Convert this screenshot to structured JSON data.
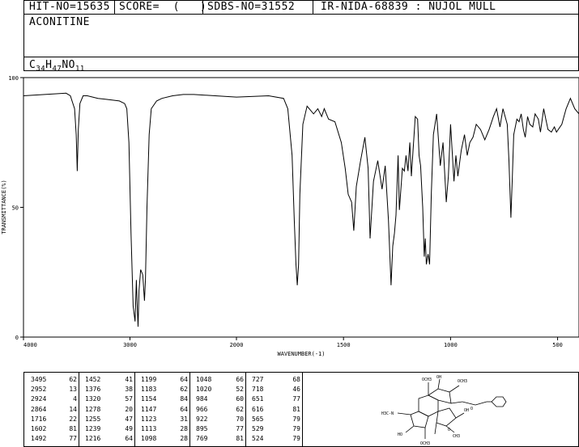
{
  "header": {
    "hit_no": "HIT-NO=15635",
    "score": "SCORE=  (   )",
    "sdbs_no": "SDBS-NO=31552",
    "ir_info": "IR-NIDA-68839 : NUJOL MULL"
  },
  "compound": {
    "name": "ACONITINE",
    "formula_parts": [
      "C",
      "34",
      "H",
      "47",
      "NO",
      "11"
    ]
  },
  "chart_data": {
    "type": "line",
    "xlabel": "WAVENUMBER(-1)",
    "ylabel": "TRANSMITTANCE(%)",
    "xlim": [
      4000,
      400
    ],
    "ylim": [
      0,
      100
    ],
    "x_ticks": [
      4000,
      3000,
      2000,
      1500,
      1000,
      500
    ],
    "y_ticks": [
      0,
      50,
      100
    ],
    "grid": false,
    "x": [
      4000,
      3800,
      3600,
      3560,
      3520,
      3505,
      3495,
      3485,
      3470,
      3440,
      3400,
      3300,
      3200,
      3100,
      3050,
      3030,
      3010,
      2990,
      2970,
      2952,
      2940,
      2930,
      2924,
      2915,
      2900,
      2880,
      2864,
      2855,
      2840,
      2820,
      2800,
      2750,
      2700,
      2600,
      2500,
      2400,
      2200,
      2000,
      1850,
      1780,
      1760,
      1740,
      1730,
      1722,
      1716,
      1710,
      1704,
      1690,
      1670,
      1640,
      1620,
      1602,
      1590,
      1570,
      1540,
      1510,
      1492,
      1478,
      1462,
      1452,
      1440,
      1420,
      1400,
      1385,
      1376,
      1360,
      1340,
      1320,
      1305,
      1290,
      1278,
      1270,
      1262,
      1255,
      1245,
      1239,
      1225,
      1216,
      1208,
      1199,
      1190,
      1183,
      1175,
      1165,
      1154,
      1147,
      1140,
      1130,
      1123,
      1118,
      1113,
      1105,
      1098,
      1090,
      1080,
      1065,
      1048,
      1035,
      1020,
      1010,
      1000,
      984,
      975,
      966,
      950,
      935,
      922,
      910,
      895,
      880,
      860,
      840,
      820,
      800,
      785,
      769,
      755,
      745,
      735,
      727,
      722,
      718,
      712,
      705,
      690,
      680,
      670,
      660,
      651,
      640,
      630,
      616,
      605,
      590,
      580,
      565,
      555,
      545,
      529,
      515,
      505,
      480,
      460,
      440,
      420,
      400
    ],
    "y": [
      93,
      93.5,
      94,
      93,
      88,
      78,
      64,
      80,
      90,
      93,
      93,
      92,
      91.5,
      91,
      90,
      88,
      75,
      40,
      12,
      6,
      22,
      10,
      4,
      18,
      26,
      24,
      14,
      22,
      50,
      78,
      88,
      91,
      92,
      93,
      93.5,
      93.5,
      93,
      92.5,
      93,
      92,
      88,
      70,
      45,
      28,
      20,
      28,
      55,
      82,
      89,
      86,
      88,
      85,
      88,
      84,
      83,
      75,
      65,
      55,
      52,
      41,
      58,
      68,
      77,
      65,
      38,
      60,
      68,
      57,
      66,
      45,
      20,
      35,
      40,
      47,
      70,
      49,
      65,
      64,
      70,
      64,
      75,
      62,
      72,
      85,
      84,
      70,
      66,
      50,
      31,
      38,
      28,
      32,
      28,
      55,
      78,
      86,
      66,
      75,
      52,
      62,
      82,
      60,
      70,
      62,
      72,
      78,
      70,
      75,
      77,
      82,
      80,
      76,
      80,
      85,
      88,
      81,
      88,
      85,
      82,
      68,
      55,
      46,
      60,
      78,
      84,
      83,
      86,
      80,
      77,
      85,
      82,
      81,
      86,
      84,
      79,
      88,
      84,
      80,
      79,
      81,
      79,
      82,
      88,
      92,
      88,
      86
    ]
  },
  "peaks": [
    [
      3495,
      62
    ],
    [
      2952,
      13
    ],
    [
      2924,
      4
    ],
    [
      2864,
      14
    ],
    [
      1716,
      22
    ],
    [
      1602,
      81
    ],
    [
      1492,
      77
    ],
    [
      1452,
      41
    ],
    [
      1376,
      38
    ],
    [
      1320,
      57
    ],
    [
      1278,
      20
    ],
    [
      1255,
      47
    ],
    [
      1239,
      49
    ],
    [
      1216,
      64
    ],
    [
      1199,
      64
    ],
    [
      1183,
      62
    ],
    [
      1154,
      84
    ],
    [
      1147,
      64
    ],
    [
      1123,
      31
    ],
    [
      1113,
      28
    ],
    [
      1098,
      28
    ],
    [
      1048,
      66
    ],
    [
      1020,
      52
    ],
    [
      984,
      60
    ],
    [
      966,
      62
    ],
    [
      922,
      70
    ],
    [
      895,
      77
    ],
    [
      769,
      81
    ],
    [
      727,
      68
    ],
    [
      718,
      46
    ],
    [
      651,
      77
    ],
    [
      616,
      81
    ],
    [
      565,
      79
    ],
    [
      529,
      79
    ],
    [
      524,
      79
    ]
  ],
  "structure_labels": {
    "och3_a": "OCH3",
    "oh_a": "OH",
    "och3_b": "OCH3",
    "och3_c": "OCH3",
    "oh_b": "OH",
    "ho": "HO",
    "h3c_n": "H3C-N",
    "ch3_ester": "CH3",
    "o_ester": "O",
    "o_bz": "O"
  }
}
